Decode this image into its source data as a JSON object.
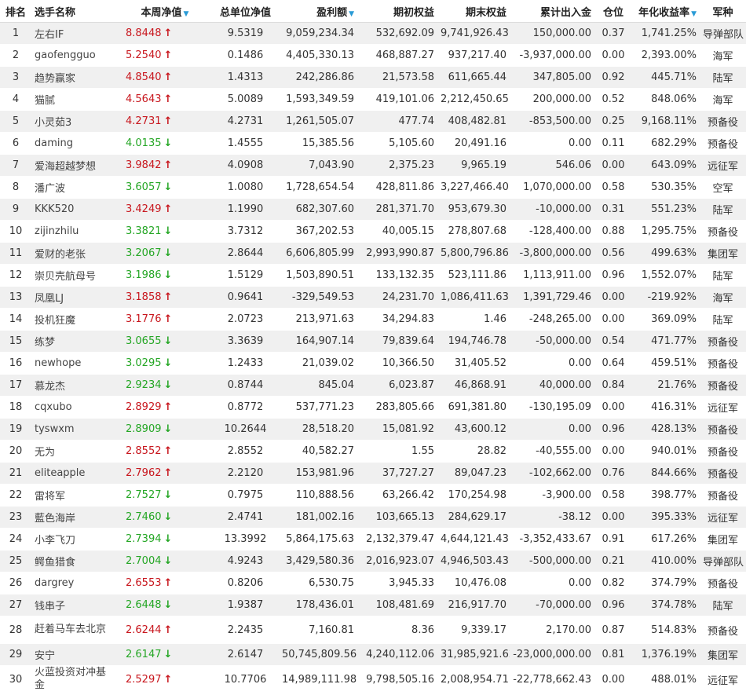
{
  "columns": {
    "rank": "排名",
    "name": "选手名称",
    "nav": "本周净值",
    "total_nav": "总单位净值",
    "profit": "盈利额",
    "start_equity": "期初权益",
    "end_equity": "期末权益",
    "cum_flow": "累计出入金",
    "position": "仓位",
    "annual_return": "年化收益率",
    "branch": "军种"
  },
  "sort_icon": "▼",
  "colors": {
    "up": "#c8161d",
    "down": "#24a624",
    "sort": "#2a9bd6",
    "stripe": "#f0f0f0"
  },
  "rows": [
    {
      "rank": "1",
      "name": "左右IF",
      "nav": "8.8448",
      "dir": "up",
      "total_nav": "9.5319",
      "profit": "9,059,234.34",
      "start": "532,692.09",
      "end": "9,741,926.43",
      "flow": "150,000.00",
      "pos": "0.37",
      "annual": "1,741.25%",
      "branch": "导弹部队"
    },
    {
      "rank": "2",
      "name": "gaofengguo",
      "nav": "5.2540",
      "dir": "up",
      "total_nav": "0.1486",
      "profit": "4,405,330.13",
      "start": "468,887.27",
      "end": "937,217.40",
      "flow": "-3,937,000.00",
      "pos": "0.00",
      "annual": "2,393.00%",
      "branch": "海军"
    },
    {
      "rank": "3",
      "name": "趋势赢家",
      "nav": "4.8540",
      "dir": "up",
      "total_nav": "1.4313",
      "profit": "242,286.86",
      "start": "21,573.58",
      "end": "611,665.44",
      "flow": "347,805.00",
      "pos": "0.92",
      "annual": "445.71%",
      "branch": "陆军"
    },
    {
      "rank": "4",
      "name": "猫腻",
      "nav": "4.5643",
      "dir": "up",
      "total_nav": "5.0089",
      "profit": "1,593,349.59",
      "start": "419,101.06",
      "end": "2,212,450.65",
      "flow": "200,000.00",
      "pos": "0.52",
      "annual": "848.06%",
      "branch": "海军"
    },
    {
      "rank": "5",
      "name": "小灵茹3",
      "nav": "4.2731",
      "dir": "up",
      "total_nav": "4.2731",
      "profit": "1,261,505.07",
      "start": "477.74",
      "end": "408,482.81",
      "flow": "-853,500.00",
      "pos": "0.25",
      "annual": "9,168.11%",
      "branch": "预备役"
    },
    {
      "rank": "6",
      "name": "daming",
      "nav": "4.0135",
      "dir": "down",
      "total_nav": "1.4555",
      "profit": "15,385.56",
      "start": "5,105.60",
      "end": "20,491.16",
      "flow": "0.00",
      "pos": "0.11",
      "annual": "682.29%",
      "branch": "预备役"
    },
    {
      "rank": "7",
      "name": "爱海超越梦想",
      "nav": "3.9842",
      "dir": "up",
      "total_nav": "4.0908",
      "profit": "7,043.90",
      "start": "2,375.23",
      "end": "9,965.19",
      "flow": "546.06",
      "pos": "0.00",
      "annual": "643.09%",
      "branch": "远征军"
    },
    {
      "rank": "8",
      "name": "潘广波",
      "nav": "3.6057",
      "dir": "down",
      "total_nav": "1.0080",
      "profit": "1,728,654.54",
      "start": "428,811.86",
      "end": "3,227,466.40",
      "flow": "1,070,000.00",
      "pos": "0.58",
      "annual": "530.35%",
      "branch": "空军"
    },
    {
      "rank": "9",
      "name": "KKK520",
      "nav": "3.4249",
      "dir": "up",
      "total_nav": "1.1990",
      "profit": "682,307.60",
      "start": "281,371.70",
      "end": "953,679.30",
      "flow": "-10,000.00",
      "pos": "0.31",
      "annual": "551.23%",
      "branch": "陆军"
    },
    {
      "rank": "10",
      "name": "zijinzhilu",
      "nav": "3.3821",
      "dir": "down",
      "total_nav": "3.7312",
      "profit": "367,202.53",
      "start": "40,005.15",
      "end": "278,807.68",
      "flow": "-128,400.00",
      "pos": "0.88",
      "annual": "1,295.75%",
      "branch": "预备役"
    },
    {
      "rank": "11",
      "name": "爱财的老张",
      "nav": "3.2067",
      "dir": "down",
      "total_nav": "2.8644",
      "profit": "6,606,805.99",
      "start": "2,993,990.87",
      "end": "5,800,796.86",
      "flow": "-3,800,000.00",
      "pos": "0.56",
      "annual": "499.63%",
      "branch": "集团军"
    },
    {
      "rank": "12",
      "name": "崇贝壳航母号",
      "nav": "3.1986",
      "dir": "down",
      "total_nav": "1.5129",
      "profit": "1,503,890.51",
      "start": "133,132.35",
      "end": "523,111.86",
      "flow": "1,113,911.00",
      "pos": "0.96",
      "annual": "1,552.07%",
      "branch": "陆军"
    },
    {
      "rank": "13",
      "name": "凤凰LJ",
      "nav": "3.1858",
      "dir": "up",
      "total_nav": "0.9641",
      "profit": "-329,549.53",
      "start": "24,231.70",
      "end": "1,086,411.63",
      "flow": "1,391,729.46",
      "pos": "0.00",
      "annual": "-219.92%",
      "branch": "海军"
    },
    {
      "rank": "14",
      "name": "投机狂魔",
      "nav": "3.1776",
      "dir": "up",
      "total_nav": "2.0723",
      "profit": "213,971.63",
      "start": "34,294.83",
      "end": "1.46",
      "flow": "-248,265.00",
      "pos": "0.00",
      "annual": "369.09%",
      "branch": "陆军"
    },
    {
      "rank": "15",
      "name": "练梦",
      "nav": "3.0655",
      "dir": "down",
      "total_nav": "3.3639",
      "profit": "164,907.14",
      "start": "79,839.64",
      "end": "194,746.78",
      "flow": "-50,000.00",
      "pos": "0.54",
      "annual": "471.77%",
      "branch": "预备役"
    },
    {
      "rank": "16",
      "name": "newhope",
      "nav": "3.0295",
      "dir": "down",
      "total_nav": "1.2433",
      "profit": "21,039.02",
      "start": "10,366.50",
      "end": "31,405.52",
      "flow": "0.00",
      "pos": "0.64",
      "annual": "459.51%",
      "branch": "预备役"
    },
    {
      "rank": "17",
      "name": "慕龙杰",
      "nav": "2.9234",
      "dir": "down",
      "total_nav": "0.8744",
      "profit": "845.04",
      "start": "6,023.87",
      "end": "46,868.91",
      "flow": "40,000.00",
      "pos": "0.84",
      "annual": "21.76%",
      "branch": "预备役"
    },
    {
      "rank": "18",
      "name": "cqxubo",
      "nav": "2.8929",
      "dir": "up",
      "total_nav": "0.8772",
      "profit": "537,771.23",
      "start": "283,805.66",
      "end": "691,381.80",
      "flow": "-130,195.09",
      "pos": "0.00",
      "annual": "416.31%",
      "branch": "远征军"
    },
    {
      "rank": "19",
      "name": "tyswxm",
      "nav": "2.8909",
      "dir": "down",
      "total_nav": "10.2644",
      "profit": "28,518.20",
      "start": "15,081.92",
      "end": "43,600.12",
      "flow": "0.00",
      "pos": "0.96",
      "annual": "428.13%",
      "branch": "预备役"
    },
    {
      "rank": "20",
      "name": "无为",
      "nav": "2.8552",
      "dir": "up",
      "total_nav": "2.8552",
      "profit": "40,582.27",
      "start": "1.55",
      "end": "28.82",
      "flow": "-40,555.00",
      "pos": "0.00",
      "annual": "940.01%",
      "branch": "预备役"
    },
    {
      "rank": "21",
      "name": "eliteapple",
      "nav": "2.7962",
      "dir": "up",
      "total_nav": "2.2120",
      "profit": "153,981.96",
      "start": "37,727.27",
      "end": "89,047.23",
      "flow": "-102,662.00",
      "pos": "0.76",
      "annual": "844.66%",
      "branch": "预备役"
    },
    {
      "rank": "22",
      "name": "雷将军",
      "nav": "2.7527",
      "dir": "down",
      "total_nav": "0.7975",
      "profit": "110,888.56",
      "start": "63,266.42",
      "end": "170,254.98",
      "flow": "-3,900.00",
      "pos": "0.58",
      "annual": "398.77%",
      "branch": "预备役"
    },
    {
      "rank": "23",
      "name": "藍色海岸",
      "nav": "2.7460",
      "dir": "down",
      "total_nav": "2.4741",
      "profit": "181,002.16",
      "start": "103,665.13",
      "end": "284,629.17",
      "flow": "-38.12",
      "pos": "0.00",
      "annual": "395.33%",
      "branch": "远征军"
    },
    {
      "rank": "24",
      "name": "小李飞刀",
      "nav": "2.7394",
      "dir": "down",
      "total_nav": "13.3992",
      "profit": "5,864,175.63",
      "start": "2,132,379.47",
      "end": "4,644,121.43",
      "flow": "-3,352,433.67",
      "pos": "0.91",
      "annual": "617.26%",
      "branch": "集团军"
    },
    {
      "rank": "25",
      "name": "鳄鱼猎食",
      "nav": "2.7004",
      "dir": "down",
      "total_nav": "4.9243",
      "profit": "3,429,580.36",
      "start": "2,016,923.07",
      "end": "4,946,503.43",
      "flow": "-500,000.00",
      "pos": "0.21",
      "annual": "410.00%",
      "branch": "导弹部队"
    },
    {
      "rank": "26",
      "name": "dargrey",
      "nav": "2.6553",
      "dir": "up",
      "total_nav": "0.8206",
      "profit": "6,530.75",
      "start": "3,945.33",
      "end": "10,476.08",
      "flow": "0.00",
      "pos": "0.82",
      "annual": "374.79%",
      "branch": "预备役"
    },
    {
      "rank": "27",
      "name": "钱串子",
      "nav": "2.6448",
      "dir": "down",
      "total_nav": "1.9387",
      "profit": "178,436.01",
      "start": "108,481.69",
      "end": "216,917.70",
      "flow": "-70,000.00",
      "pos": "0.96",
      "annual": "374.78%",
      "branch": "陆军"
    },
    {
      "rank": "28",
      "name": "赶着马车去北京",
      "nav": "2.6244",
      "dir": "up",
      "total_nav": "2.2435",
      "profit": "7,160.81",
      "start": "8.36",
      "end": "9,339.17",
      "flow": "2,170.00",
      "pos": "0.87",
      "annual": "514.83%",
      "branch": "预备役"
    },
    {
      "rank": "29",
      "name": "安宁",
      "nav": "2.6147",
      "dir": "down",
      "total_nav": "2.6147",
      "profit": "50,745,809.56",
      "start": "4,240,112.06",
      "end": "31,985,921.62",
      "flow": "-23,000,000.00",
      "pos": "0.81",
      "annual": "1,376.19%",
      "branch": "集团军"
    },
    {
      "rank": "30",
      "name": "火蓝投资对冲基金",
      "nav": "2.5297",
      "dir": "up",
      "total_nav": "10.7706",
      "profit": "14,989,111.98",
      "start": "9,798,505.16",
      "end": "2,008,954.71",
      "flow": "-22,778,662.43",
      "pos": "0.00",
      "annual": "488.01%",
      "branch": "远征军"
    }
  ]
}
